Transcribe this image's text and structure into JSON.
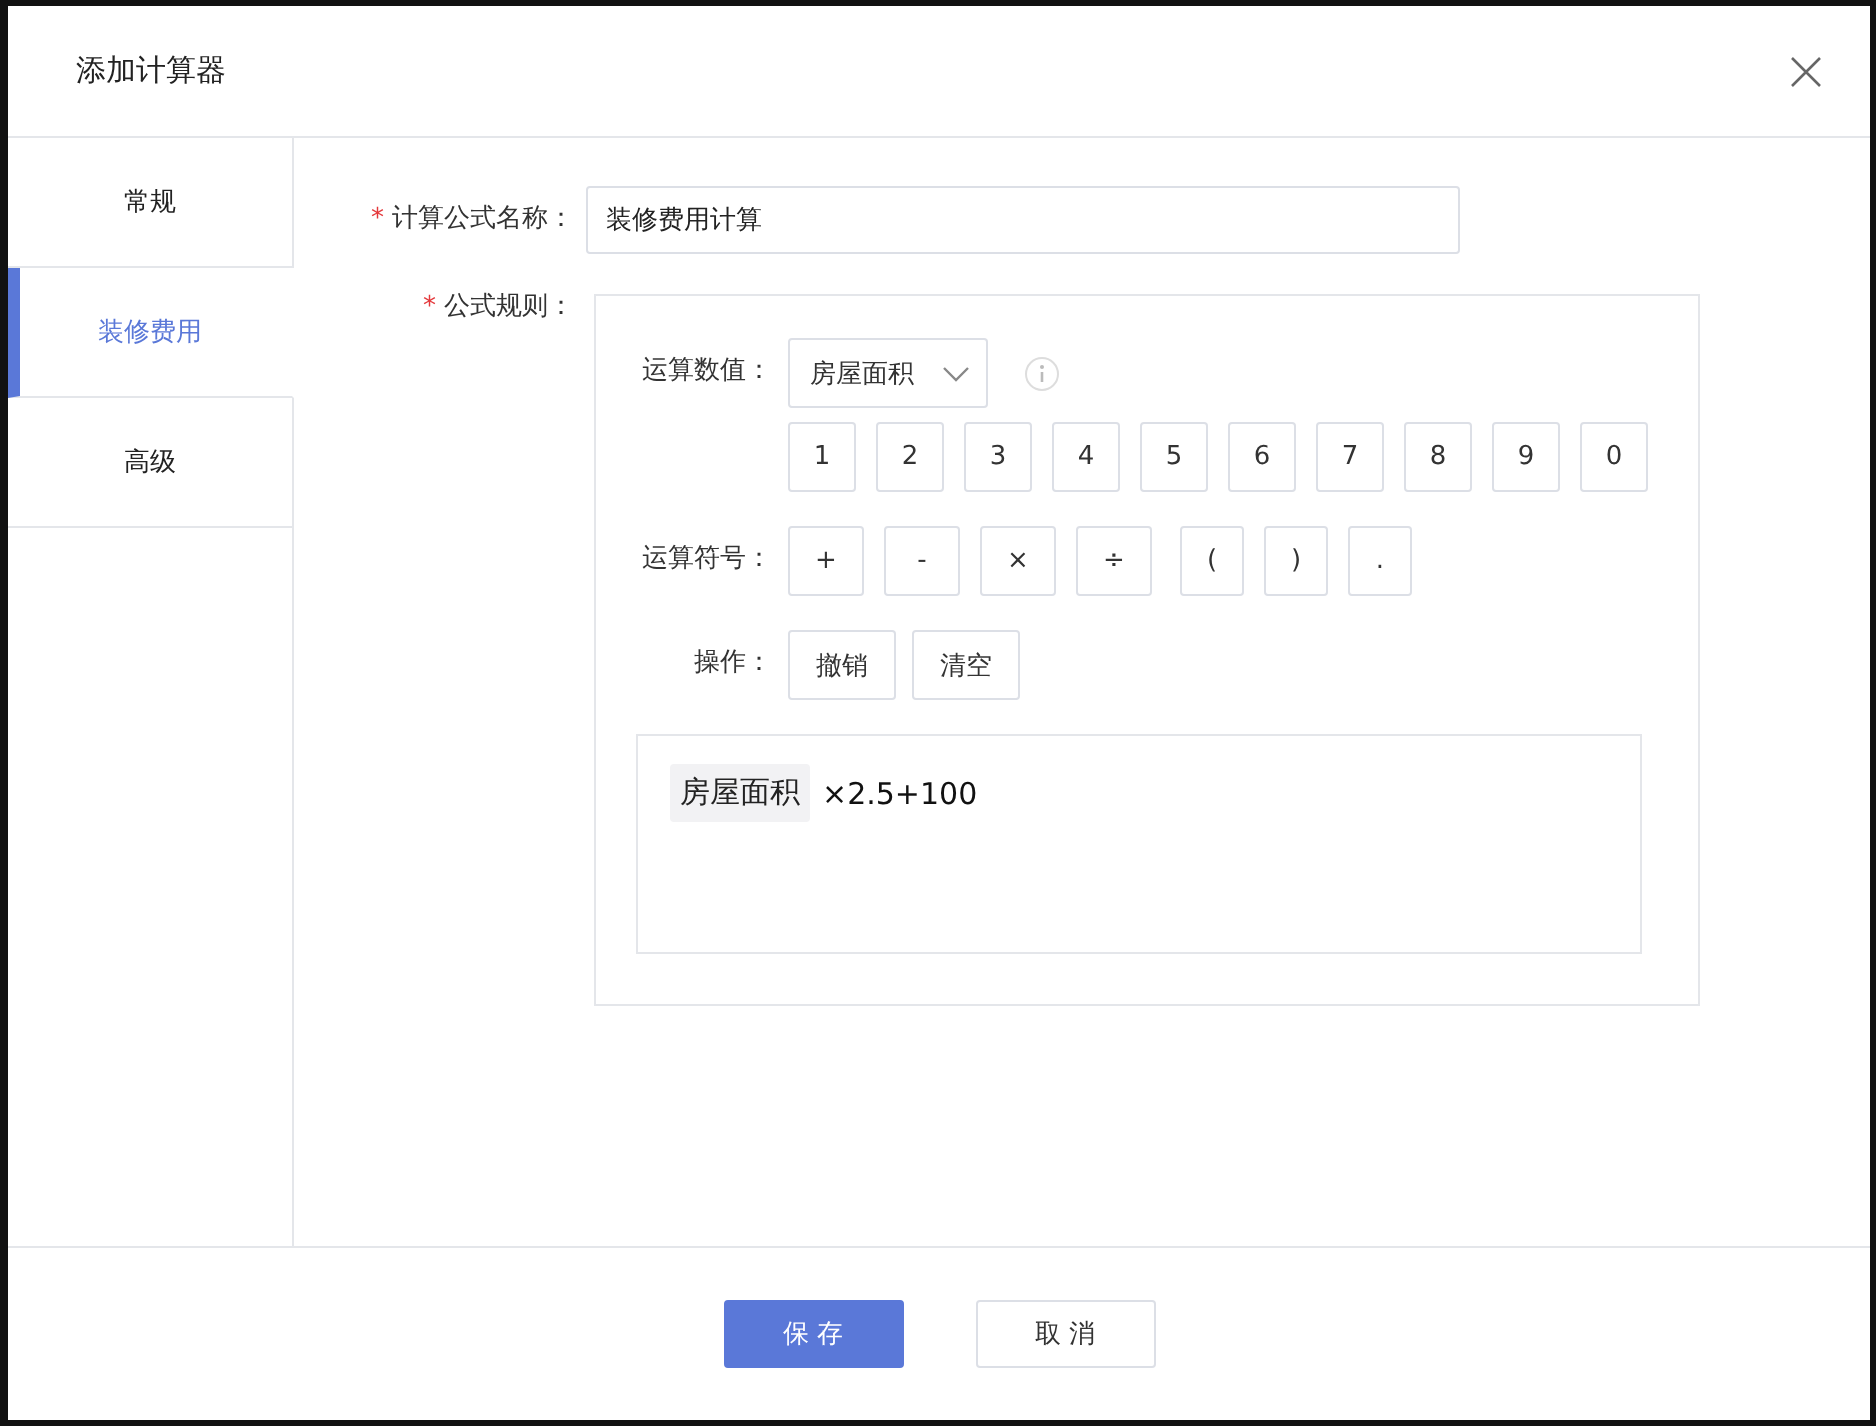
{
  "window": {
    "title": "添加计算器"
  },
  "sidebar": {
    "items": [
      {
        "label": "常规",
        "selected": false
      },
      {
        "label": "装修费用",
        "selected": true
      },
      {
        "label": "高级",
        "selected": false
      }
    ]
  },
  "form": {
    "name_field": {
      "required_mark": "*",
      "label": "计算公式名称：",
      "value": "装修费用计算"
    },
    "rule": {
      "required_mark": "*",
      "label": "公式规则：",
      "value_row": {
        "label": "运算数值：",
        "select_value": "房屋面积",
        "digits": [
          "1",
          "2",
          "3",
          "4",
          "5",
          "6",
          "7",
          "8",
          "9",
          "0"
        ]
      },
      "operator_row": {
        "label": "运算符号：",
        "operators": [
          "+",
          "-",
          "×",
          "÷",
          "(",
          ")",
          "."
        ]
      },
      "action_row": {
        "label": "操作：",
        "actions": [
          "撤销",
          "清空"
        ]
      },
      "expression": {
        "token": "房屋面积",
        "text": "×2.5+100"
      }
    }
  },
  "buttons": [
    {
      "label": "保 存",
      "kind": "primary"
    },
    {
      "label": "取 消",
      "kind": "default"
    }
  ]
}
